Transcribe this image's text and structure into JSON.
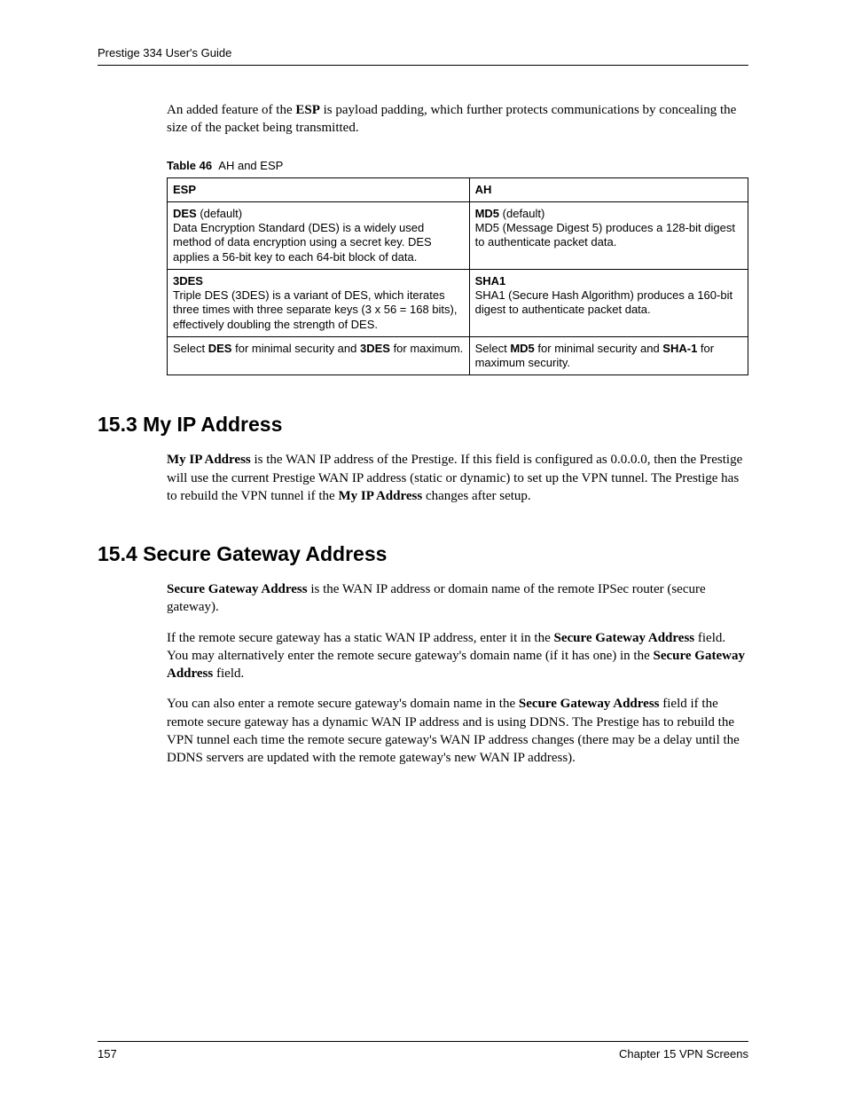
{
  "header": {
    "title": "Prestige 334 User's Guide"
  },
  "intro": {
    "p1_a": "An added feature of the ",
    "p1_b": "ESP",
    "p1_c": " is payload padding, which further protects communications by concealing the size of the packet being transmitted."
  },
  "table": {
    "caption_label": "Table 46",
    "caption_title": "AH and ESP",
    "head_esp": "ESP",
    "head_ah": "AH",
    "row1": {
      "esp_title_b": "DES",
      "esp_title_rest": " (default)",
      "esp_body": "Data Encryption Standard (DES) is a widely used method of data encryption using a secret key. DES applies a 56-bit key to each 64-bit block of data.",
      "ah_title_b": "MD5",
      "ah_title_rest": " (default)",
      "ah_body": "MD5 (Message Digest 5) produces a 128-bit digest to authenticate packet data."
    },
    "row2": {
      "esp_title_b": "3DES",
      "esp_body": "Triple DES (3DES) is a variant of DES, which iterates three times with three separate keys (3 x 56 = 168 bits), effectively doubling the strength of DES.",
      "ah_title_b": "SHA1",
      "ah_body": "SHA1 (Secure Hash Algorithm) produces a 160-bit digest to authenticate packet data."
    },
    "row3": {
      "esp_a": "Select ",
      "esp_b1": "DES",
      "esp_c": " for minimal security and ",
      "esp_b2": "3DES",
      "esp_d": " for maximum.",
      "ah_a": "Select ",
      "ah_b1": "MD5",
      "ah_c": " for minimal security and ",
      "ah_b2": "SHA-1",
      "ah_d": " for maximum security."
    }
  },
  "sec153": {
    "heading": "15.3  My IP Address",
    "p1_b": "My IP Address",
    "p1_a": " is the WAN IP address of the Prestige. If this field is configured as 0.0.0.0, then the Prestige will use the current Prestige WAN IP address (static or dynamic) to set up the VPN tunnel. The Prestige has to rebuild the VPN tunnel if the ",
    "p1_b2": "My IP Address",
    "p1_c": " changes after setup."
  },
  "sec154": {
    "heading": "15.4  Secure Gateway Address",
    "p1_b": "Secure Gateway Address",
    "p1_a": " is the WAN IP address or domain name of the remote IPSec router (secure gateway).",
    "p2_a": "If the remote secure gateway has a static WAN IP address, enter it in the ",
    "p2_b": "Secure Gateway Address",
    "p2_c": " field. You may alternatively enter the remote secure gateway's domain name (if it has one) in the ",
    "p2_b2": "Secure Gateway Address",
    "p2_d": " field.",
    "p3_a": "You can also enter a remote secure gateway's domain name in the ",
    "p3_b": "Secure Gateway Address",
    "p3_c": " field if the remote secure gateway has a dynamic WAN IP address and is using DDNS. The Prestige has to rebuild the VPN tunnel each time the remote secure gateway's WAN IP address changes (there may be a delay until the DDNS servers are updated with the remote gateway's new WAN IP address)."
  },
  "footer": {
    "page": "157",
    "chapter": "Chapter 15 VPN Screens"
  }
}
